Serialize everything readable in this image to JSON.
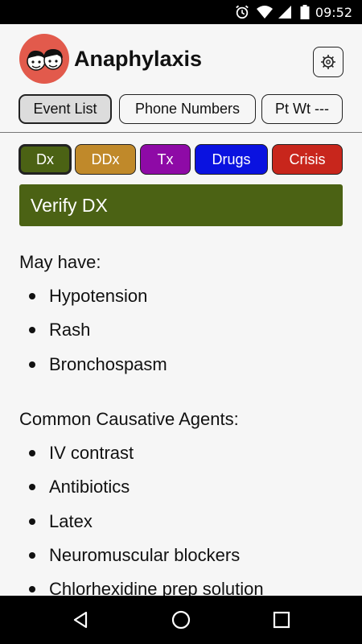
{
  "status_bar": {
    "time": "09:52",
    "icons": [
      "alarm-icon",
      "wifi-icon",
      "cell-signal-icon",
      "battery-icon"
    ]
  },
  "header": {
    "app_title": "Anaphylaxis",
    "settings_icon": "gear-icon",
    "buttons": [
      {
        "label": "Event List",
        "active": true
      },
      {
        "label": "Phone Numbers",
        "active": false
      },
      {
        "label": "Pt Wt ---",
        "active": false
      }
    ]
  },
  "tabs": [
    {
      "label": "Dx",
      "color": "#4b6214",
      "active": true
    },
    {
      "label": "DDx",
      "color": "#c0892a",
      "active": false
    },
    {
      "label": "Tx",
      "color": "#8e0aa6",
      "active": false
    },
    {
      "label": "Drugs",
      "color": "#0a12e0",
      "active": false
    },
    {
      "label": "Crisis",
      "color": "#c8261c",
      "active": false
    }
  ],
  "section": {
    "title": "Verify DX"
  },
  "content": {
    "groups": [
      {
        "heading": "May have:",
        "items": [
          "Hypotension",
          "Rash",
          "Bronchospasm"
        ]
      },
      {
        "heading": "Common Causative Agents:",
        "items": [
          "IV contrast",
          "Antibiotics",
          "Latex",
          "Neuromuscular blockers",
          "Chlorhexidine prep solution"
        ]
      }
    ]
  },
  "nav_bar": {
    "icons": [
      "back-icon",
      "home-icon",
      "recents-icon"
    ]
  }
}
